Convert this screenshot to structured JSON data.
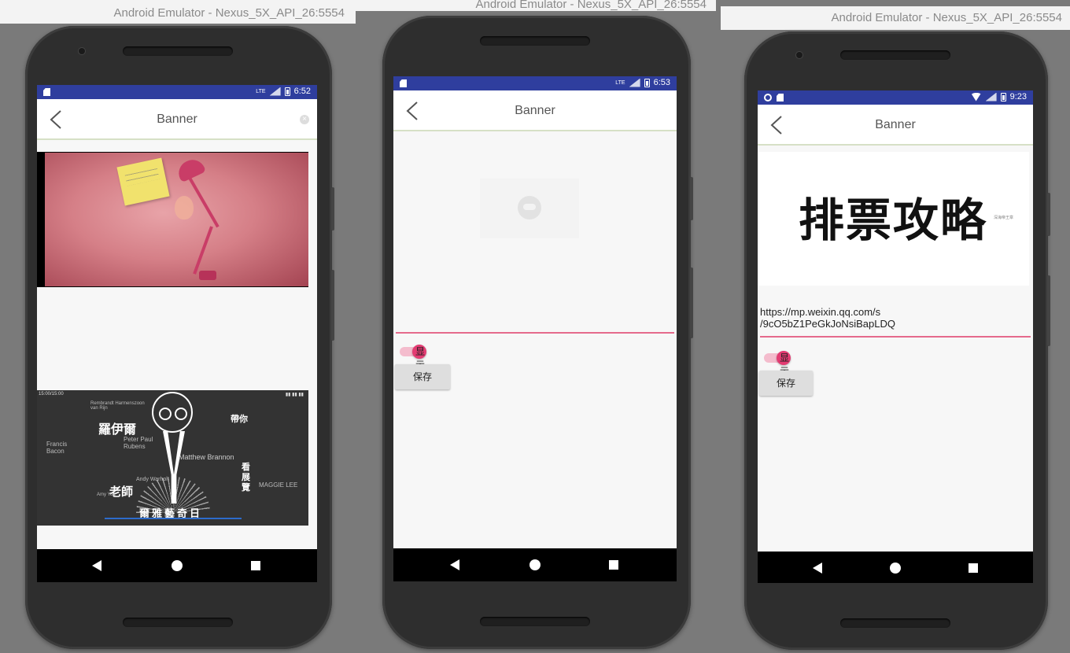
{
  "window_title": "Android Emulator - Nexus_5X_API_26:5554",
  "app_title": "Banner",
  "emulators": [
    {
      "status_time": "6:52",
      "status_network": "LTE"
    },
    {
      "status_time": "6:53",
      "status_network": "LTE",
      "toggle_label": "显示",
      "save_label": "保存"
    },
    {
      "status_time": "9:23",
      "url_line1": "https://mp.weixin.qq.com/s",
      "url_line2": "/9cO5bZ1PeGkJoNsiBapLDQ",
      "toggle_label": "显示",
      "save_label": "保存",
      "banner_text": "排票攻略",
      "banner_small": "深海帝王章"
    }
  ],
  "wordcloud": {
    "time": "15:00/15:00",
    "words": [
      "Rembrandt Harmenszoon van Rijn",
      "羅伊爾",
      "Peter Paul Rubens",
      "Francis Bacon",
      "Matthew Brannon",
      "老師",
      "爾雅藝奇日",
      "MAGGIE LEE",
      "看展覽",
      "帶你",
      "Andy Warhol",
      "Amy Yoa"
    ]
  },
  "colors": {
    "statusbar": "#2f3e9e",
    "accent": "#e33b72",
    "underline": "#e56a8c"
  }
}
